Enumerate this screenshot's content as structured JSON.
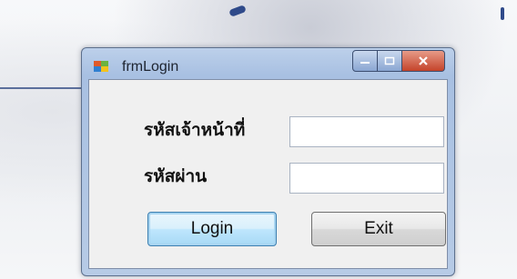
{
  "window": {
    "title": "frmLogin",
    "app_icon": "app-icon",
    "minimize_icon": "minimize-icon",
    "maximize_icon": "maximize-icon",
    "close_icon": "close-icon"
  },
  "form": {
    "staff_id_label": "รหัสเจ้าหน้าที่",
    "staff_id_value": "",
    "password_label": "รหัสผ่าน",
    "password_value": "",
    "login_label": "Login",
    "exit_label": "Exit"
  }
}
